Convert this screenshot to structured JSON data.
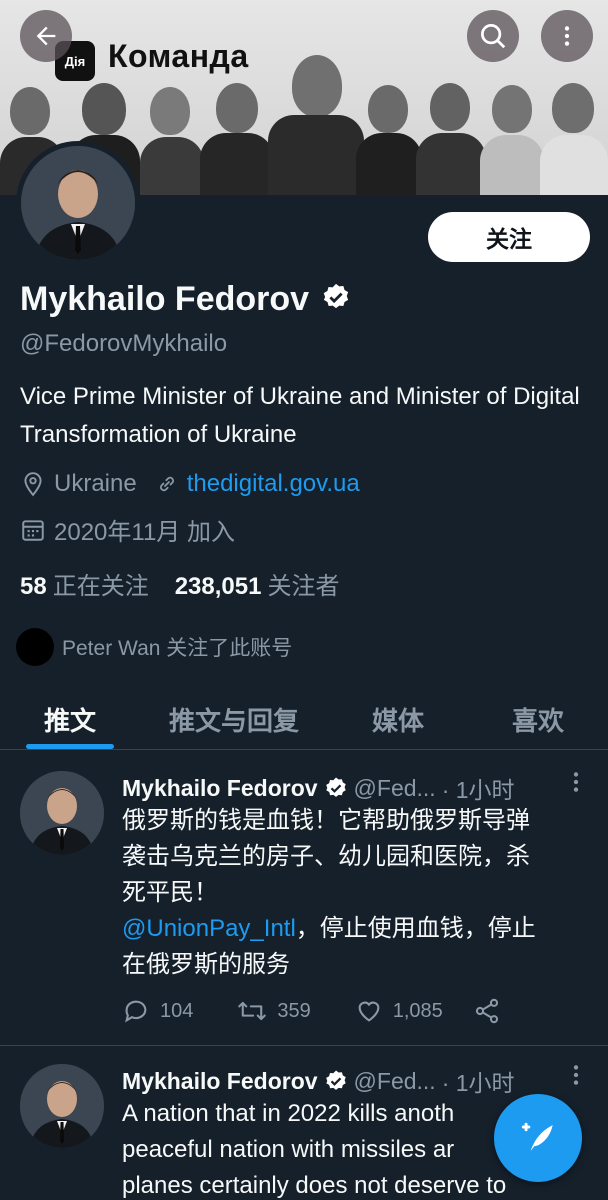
{
  "banner": {
    "logo_text": "Дія",
    "title": "Команда"
  },
  "profile": {
    "follow_label": "关注",
    "name": "Mykhailo Fedorov",
    "handle": "@FedorovMykhailo",
    "bio": "Vice Prime Minister of Ukraine and Minister of Digital Transformation of Ukraine",
    "location": "Ukraine",
    "website": "thedigital.gov.ua",
    "joined": "2020年11月 加入",
    "following_count": "58",
    "following_label": "正在关注",
    "followers_count": "238,051",
    "followers_label": "关注者",
    "followed_by": "Peter Wan 关注了此账号"
  },
  "tabs": [
    {
      "label": "推文"
    },
    {
      "label": "推文与回复"
    },
    {
      "label": "媒体"
    },
    {
      "label": "喜欢"
    }
  ],
  "tweets": [
    {
      "name": "Mykhailo Fedorov",
      "handle": "@Fed...",
      "time": "· 1小时",
      "text_line1": "俄罗斯的钱是血钱！它帮助俄罗斯导弹",
      "text_line2": "袭击乌克兰的房子、幼儿园和医院，杀",
      "text_line3": "死平民！",
      "mention": "@UnionPay_Intl",
      "text_line4_rest": "，停止使用血钱，停止",
      "text_line5": "在俄罗斯的服务",
      "replies": "104",
      "retweets": "359",
      "likes": "1,085"
    },
    {
      "name": "Mykhailo Fedorov",
      "handle": "@Fed...",
      "time": "· 1小时",
      "text_line1": "A nation that in 2022 kills anoth",
      "text_line2": "peaceful nation with missiles ar",
      "text_line3": "planes certainly does not deserve to"
    }
  ],
  "colors": {
    "background": "#15202b",
    "accent": "#1d9bf0",
    "secondary_text": "#8b98a5"
  }
}
